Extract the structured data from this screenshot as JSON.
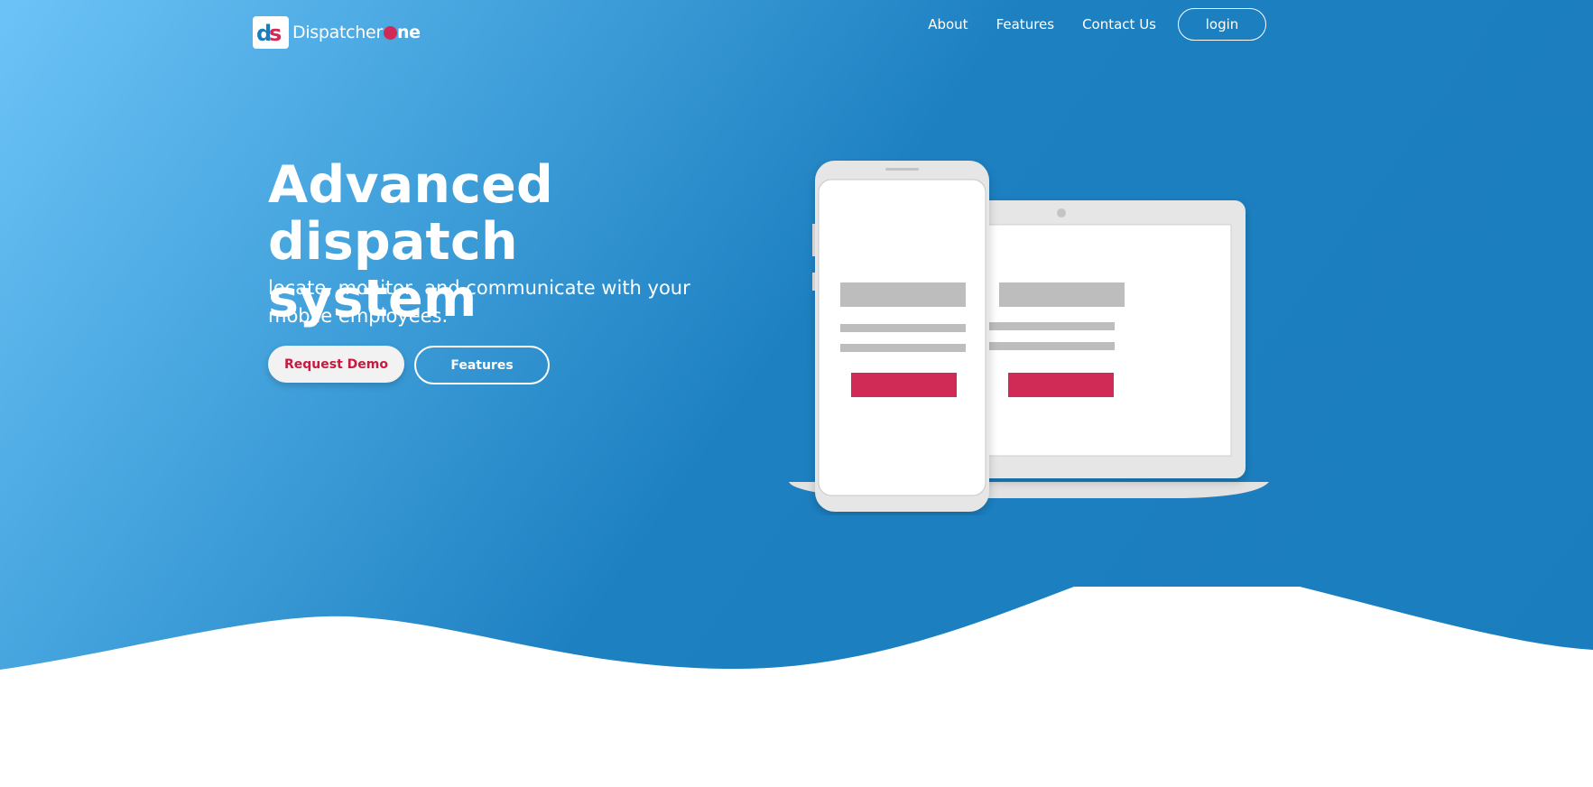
{
  "brand": {
    "name_prefix": "Dispatcher",
    "name_suffix": "ne",
    "mark_letters": "ds"
  },
  "nav": {
    "items": [
      {
        "label": "About"
      },
      {
        "label": "Features"
      },
      {
        "label": "Contact Us"
      }
    ],
    "login_label": "login"
  },
  "hero": {
    "title_line1": "Advanced",
    "title_line2": "dispatch system",
    "subtitle": "locate, monitor, and communicate with your mobile employees.",
    "primary_button": "Request Demo",
    "secondary_button": "Features"
  },
  "illustration": {
    "icons": [
      "phone-illustration",
      "laptop-illustration"
    ]
  },
  "colors": {
    "accent": "#c8193f",
    "brand_red": "#d02b56",
    "hero_blue": "#1a7dbd",
    "hero_light_blue": "#6cc3f7",
    "placeholder_gray": "#bdbdbd"
  }
}
